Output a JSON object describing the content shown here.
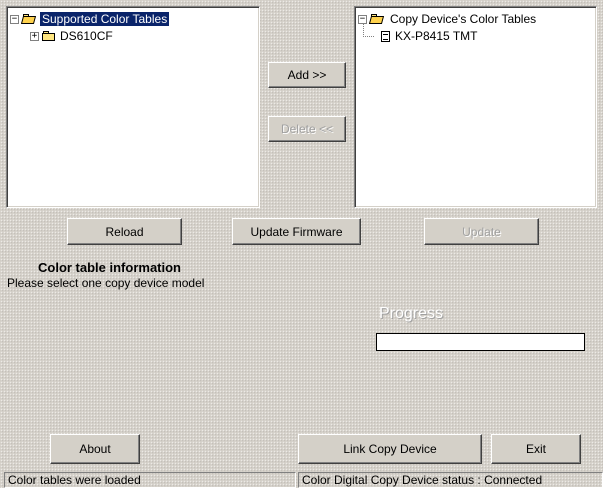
{
  "left_tree": {
    "root_label": "Supported Color Tables",
    "child_label": "DS610CF"
  },
  "right_tree": {
    "root_label": "Copy Device's Color Tables",
    "child_label": "KX-P8415 TMT"
  },
  "buttons": {
    "add": "Add >>",
    "delete": "Delete <<",
    "reload": "Reload",
    "update_firmware": "Update Firmware",
    "update": "Update",
    "about": "About",
    "link_copy_device": "Link Copy Device",
    "exit": "Exit"
  },
  "info": {
    "heading": "Color table information",
    "message": "Please select one copy device model"
  },
  "progress": {
    "label": "Progress",
    "value": 0
  },
  "status_bar": {
    "left": "Color tables were loaded",
    "right": "Color Digital Copy Device status : Connected"
  },
  "colors": {
    "background": "#d4d0c8",
    "selection": "#0a246a",
    "disabled_text": "#a0a0a0"
  }
}
